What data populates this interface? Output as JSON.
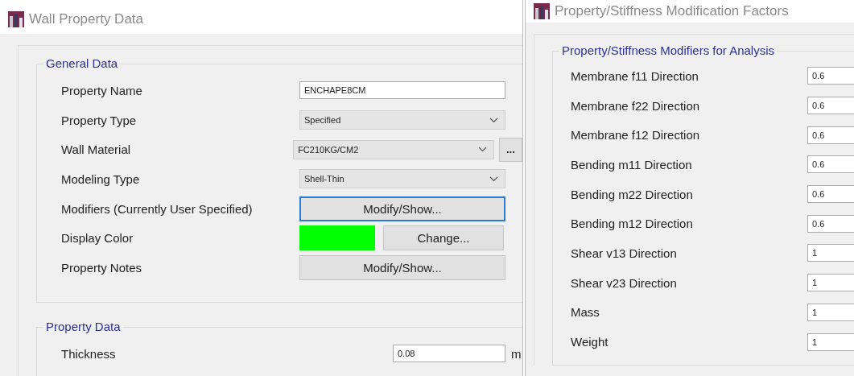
{
  "wall_property_window": {
    "title": "Wall Property Data",
    "general_data": {
      "title": "General Data",
      "rows": [
        {
          "kind": "text",
          "label": "Property Name",
          "value": "ENCHAPE8CM"
        },
        {
          "kind": "dropdown",
          "label": "Property Type",
          "value": "Specified"
        },
        {
          "kind": "dropdown_browse",
          "label": "Wall Material",
          "value": "FC210KG/CM2",
          "button": "..."
        },
        {
          "kind": "dropdown",
          "label": "Modeling Type",
          "value": "Shell-Thin"
        },
        {
          "kind": "button",
          "label": "Modifiers (Currently User Specified)",
          "button": "Modify/Show...",
          "focused": true
        },
        {
          "kind": "color",
          "label": "Display Color",
          "color": "#00ff00",
          "button": "Change..."
        },
        {
          "kind": "button",
          "label": "Property Notes",
          "button": "Modify/Show...",
          "focused": false
        }
      ]
    },
    "property_data": {
      "title": "Property Data",
      "rows": [
        {
          "label": "Thickness",
          "value": "0.08",
          "unit": "m"
        }
      ]
    }
  },
  "modification_window": {
    "title": "Property/Stiffness Modification Factors",
    "group": {
      "title": "Property/Stiffness Modifiers for Analysis",
      "rows": [
        {
          "label": "Membrane f11 Direction",
          "value": "0.6"
        },
        {
          "label": "Membrane f22 Direction",
          "value": "0.6"
        },
        {
          "label": "Membrane f12 Direction",
          "value": "0.6"
        },
        {
          "label": "Bending m11 Direction",
          "value": "0.6"
        },
        {
          "label": "Bending m22 Direction",
          "value": "0.6"
        },
        {
          "label": "Bending m12 Direction",
          "value": "0.6"
        },
        {
          "label": "Shear v13 Direction",
          "value": "1"
        },
        {
          "label": "Shear v23 Direction",
          "value": "1"
        },
        {
          "label": "Mass",
          "value": "1"
        },
        {
          "label": "Weight",
          "value": "1"
        }
      ]
    }
  }
}
